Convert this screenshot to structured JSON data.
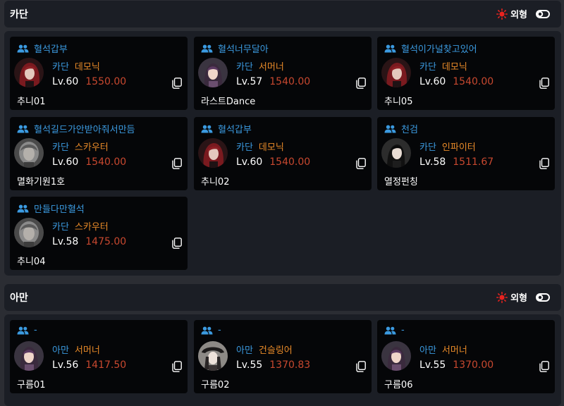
{
  "mode_label": "외형",
  "sections": [
    {
      "title": "카단",
      "cards": [
        {
          "party": "혈석갑부",
          "server": "카단",
          "class": "데모닉",
          "level": "Lv.60",
          "item_level": "1550.00",
          "name": "추니01",
          "avatar": "demonic"
        },
        {
          "party": "혈석너무달아",
          "server": "카단",
          "class": "서머너",
          "level": "Lv.57",
          "item_level": "1540.00",
          "name": "라스트Dance",
          "avatar": "summoner"
        },
        {
          "party": "혈석이가널찾고있어",
          "server": "카단",
          "class": "데모닉",
          "level": "Lv.60",
          "item_level": "1540.00",
          "name": "추니05",
          "avatar": "demonic"
        },
        {
          "party": "혈석길드가안받아줘서만듬",
          "server": "카단",
          "class": "스카우터",
          "level": "Lv.60",
          "item_level": "1540.00",
          "name": "멸화기원1호",
          "avatar": "scouter"
        },
        {
          "party": "혈석갑부",
          "server": "카단",
          "class": "데모닉",
          "level": "Lv.60",
          "item_level": "1540.00",
          "name": "추니02",
          "avatar": "demonic"
        },
        {
          "party": "천검",
          "server": "카단",
          "class": "인파이터",
          "level": "Lv.58",
          "item_level": "1511.67",
          "name": "열정펀칭",
          "avatar": "infighter"
        },
        {
          "party": "만들다만혈석",
          "server": "카단",
          "class": "스카우터",
          "level": "Lv.58",
          "item_level": "1475.00",
          "name": "추니04",
          "avatar": "scouter"
        }
      ]
    },
    {
      "title": "아만",
      "cards": [
        {
          "party": "-",
          "server": "아만",
          "class": "서머너",
          "level": "Lv.56",
          "item_level": "1417.50",
          "name": "구름01",
          "avatar": "summoner"
        },
        {
          "party": "-",
          "server": "아만",
          "class": "건슬링어",
          "level": "Lv.55",
          "item_level": "1370.83",
          "name": "구름02",
          "avatar": "gunslinger"
        },
        {
          "party": "-",
          "server": "아만",
          "class": "서머너",
          "level": "Lv.55",
          "item_level": "1370.00",
          "name": "구름06",
          "avatar": "summoner"
        }
      ]
    }
  ]
}
